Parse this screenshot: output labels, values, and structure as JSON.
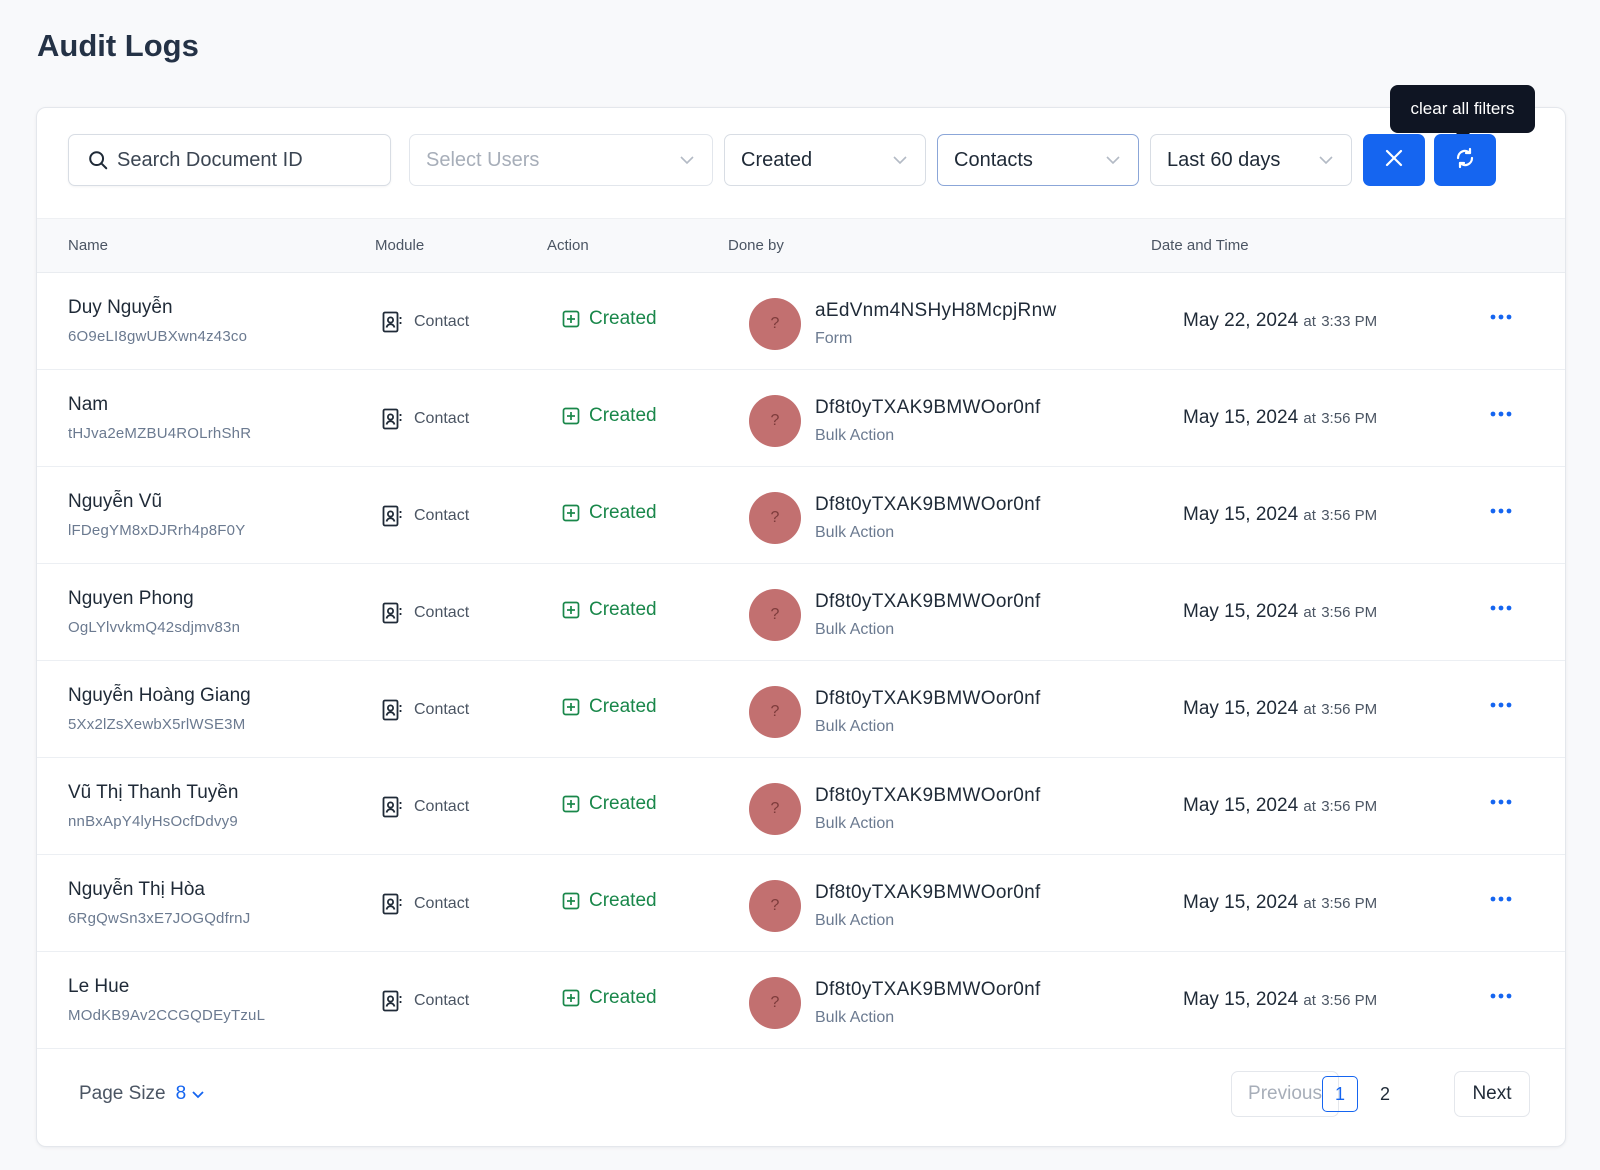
{
  "page": {
    "title": "Audit Logs"
  },
  "filters": {
    "search_placeholder": "Search Document ID",
    "users_placeholder": "Select Users",
    "action_value": "Created",
    "module_value": "Contacts",
    "range_value": "Last 60 days",
    "clear_tooltip": "clear all filters"
  },
  "table": {
    "columns": [
      "Name",
      "Module",
      "Action",
      "Done by",
      "Date and Time"
    ],
    "rows": [
      {
        "name": "Duy Nguyễn",
        "id": "6O9eLI8gwUBXwn4z43co",
        "module": "Contact",
        "action": "Created",
        "avatar": "?",
        "done_by": "aEdVnm4NSHyH8McpjRnw",
        "source": "Form",
        "date": "May 22, 2024",
        "at": "at",
        "time": "3:33 PM"
      },
      {
        "name": "Nam",
        "id": "tHJva2eMZBU4ROLrhShR",
        "module": "Contact",
        "action": "Created",
        "avatar": "?",
        "done_by": "Df8t0yTXAK9BMWOor0nf",
        "source": "Bulk Action",
        "date": "May 15, 2024",
        "at": "at",
        "time": "3:56 PM"
      },
      {
        "name": "Nguyễn Vũ",
        "id": "lFDegYM8xDJRrh4p8F0Y",
        "module": "Contact",
        "action": "Created",
        "avatar": "?",
        "done_by": "Df8t0yTXAK9BMWOor0nf",
        "source": "Bulk Action",
        "date": "May 15, 2024",
        "at": "at",
        "time": "3:56 PM"
      },
      {
        "name": "Nguyen Phong",
        "id": "OgLYlvvkmQ42sdjmv83n",
        "module": "Contact",
        "action": "Created",
        "avatar": "?",
        "done_by": "Df8t0yTXAK9BMWOor0nf",
        "source": "Bulk Action",
        "date": "May 15, 2024",
        "at": "at",
        "time": "3:56 PM"
      },
      {
        "name": "Nguyễn Hoàng Giang",
        "id": "5Xx2lZsXewbX5rlWSE3M",
        "module": "Contact",
        "action": "Created",
        "avatar": "?",
        "done_by": "Df8t0yTXAK9BMWOor0nf",
        "source": "Bulk Action",
        "date": "May 15, 2024",
        "at": "at",
        "time": "3:56 PM"
      },
      {
        "name": "Vũ Thị Thanh Tuyền",
        "id": "nnBxApY4lyHsOcfDdvy9",
        "module": "Contact",
        "action": "Created",
        "avatar": "?",
        "done_by": "Df8t0yTXAK9BMWOor0nf",
        "source": "Bulk Action",
        "date": "May 15, 2024",
        "at": "at",
        "time": "3:56 PM"
      },
      {
        "name": "Nguyễn Thị Hòa",
        "id": "6RgQwSn3xE7JOGQdfrnJ",
        "module": "Contact",
        "action": "Created",
        "avatar": "?",
        "done_by": "Df8t0yTXAK9BMWOor0nf",
        "source": "Bulk Action",
        "date": "May 15, 2024",
        "at": "at",
        "time": "3:56 PM"
      },
      {
        "name": "Le Hue",
        "id": "MOdKB9Av2CCGQDEyTzuL",
        "module": "Contact",
        "action": "Created",
        "avatar": "?",
        "done_by": "Df8t0yTXAK9BMWOor0nf",
        "source": "Bulk Action",
        "date": "May 15, 2024",
        "at": "at",
        "time": "3:56 PM"
      }
    ]
  },
  "footer": {
    "page_size_label": "Page Size",
    "page_size_value": "8",
    "previous": "Previous",
    "next": "Next",
    "pages": [
      "1",
      "2"
    ],
    "current_page": "1"
  },
  "colors": {
    "accent": "#1565f0",
    "success": "#19874a",
    "avatar": "#c27070"
  },
  "icons": [
    "search-icon",
    "chevron-down-icon",
    "close-icon",
    "refresh-icon",
    "contact-card-icon",
    "plus-square-icon",
    "more-horizontal-icon"
  ]
}
